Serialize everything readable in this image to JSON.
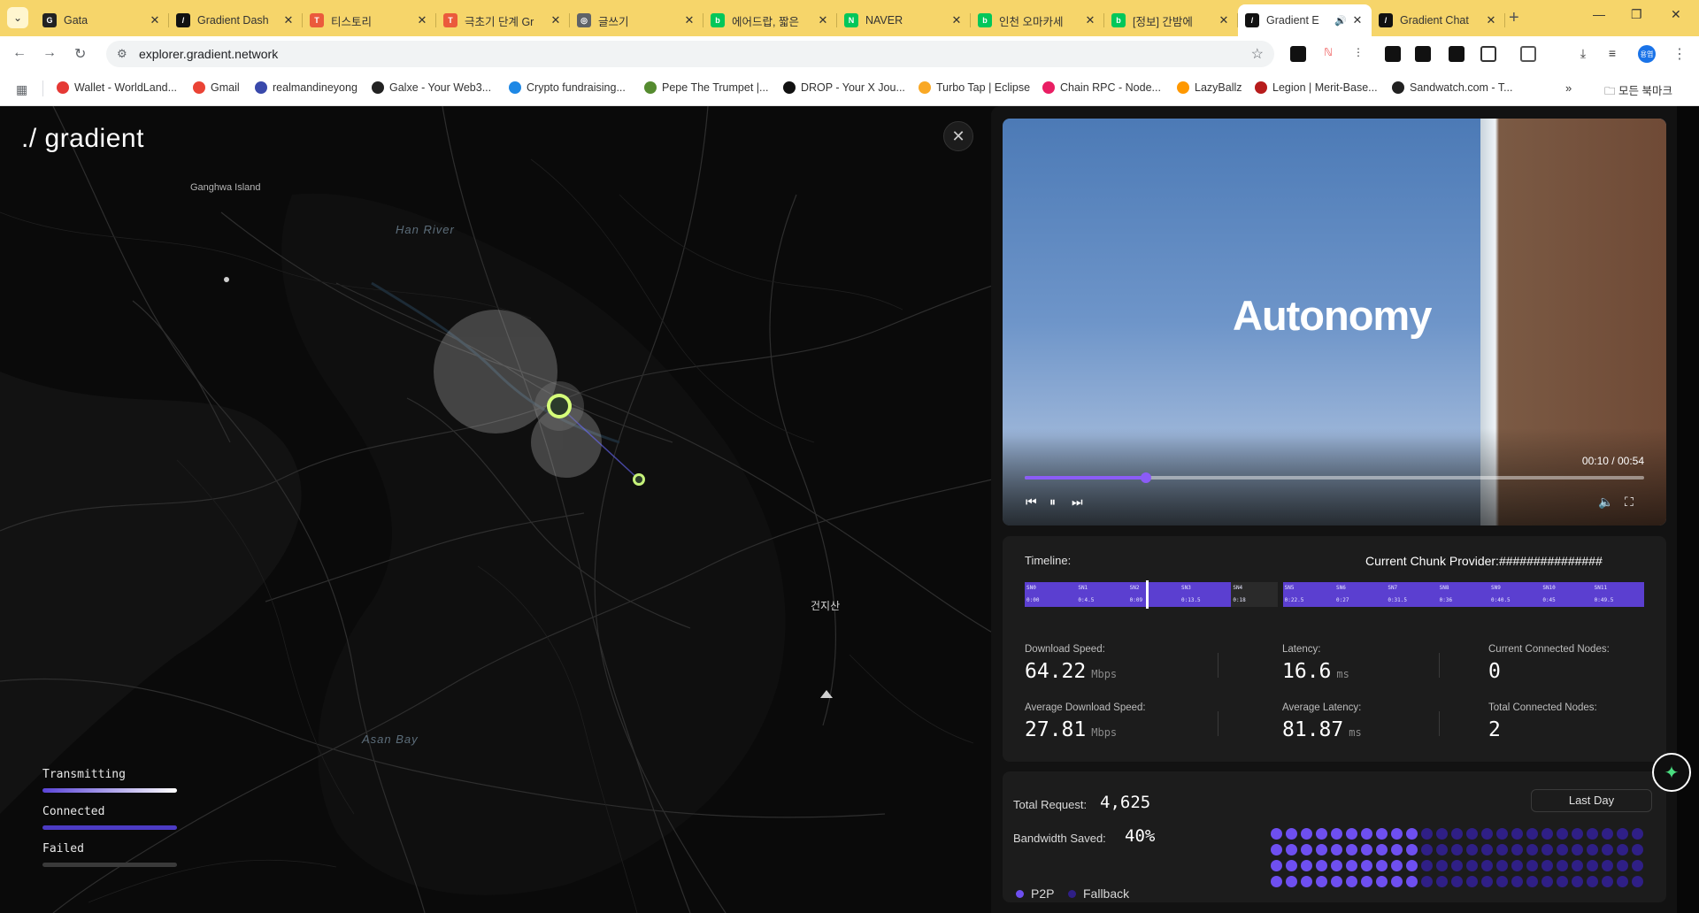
{
  "browser": {
    "tabs": [
      {
        "title": "Gata",
        "color": "#222222",
        "glyph": "G"
      },
      {
        "title": "Gradient Dash",
        "color": "#111111",
        "glyph": "/"
      },
      {
        "title": "티스토리",
        "color": "#eb5a3c",
        "glyph": "T"
      },
      {
        "title": "극초기 단계 Gr",
        "color": "#eb5a3c",
        "glyph": "T"
      },
      {
        "title": "글쓰기",
        "color": "#5f6368",
        "glyph": "◎"
      },
      {
        "title": "에어드랍, 짧은",
        "color": "#03c75a",
        "glyph": "b"
      },
      {
        "title": "NAVER",
        "color": "#03c75a",
        "glyph": "N"
      },
      {
        "title": "인천 오마카세",
        "color": "#03c75a",
        "glyph": "b"
      },
      {
        "title": "[정보] 간밤에",
        "color": "#03c75a",
        "glyph": "b"
      },
      {
        "title": "Gradient E",
        "color": "#111111",
        "glyph": "/"
      },
      {
        "title": "Gradient Chat",
        "color": "#111111",
        "glyph": "/"
      }
    ],
    "active_tab_index": 9,
    "url": "explorer.gradient.network",
    "bookmarks": [
      {
        "label": "Wallet - WorldLand...",
        "color": "#e53935"
      },
      {
        "label": "Gmail",
        "color": "#ea4335"
      },
      {
        "label": "realmandineyong",
        "color": "#3949ab"
      },
      {
        "label": "Galxe - Your Web3...",
        "color": "#222222"
      },
      {
        "label": "Crypto fundraising...",
        "color": "#1e88e5"
      },
      {
        "label": "Pepe The Trumpet |...",
        "color": "#558b2f"
      },
      {
        "label": "DROP - Your X Jou...",
        "color": "#111111"
      },
      {
        "label": "Turbo Tap | Eclipse",
        "color": "#f9a825"
      },
      {
        "label": "Chain RPC - Node...",
        "color": "#e91e63"
      },
      {
        "label": "LazyBallz",
        "color": "#ff9800"
      },
      {
        "label": "Legion | Merit-Base...",
        "color": "#b71c1c"
      },
      {
        "label": "Sandwatch.com - T...",
        "color": "#212121"
      }
    ],
    "bookmarks_more": "»",
    "all_bookmarks": "모든 북마크",
    "profile_initial": "용엽"
  },
  "map": {
    "logo": "./ gradient",
    "labels": {
      "ganghwa": "Ganghwa Island",
      "han_river": "Han River",
      "asan_bay": "Asan Bay",
      "geonjisan": "건지산"
    },
    "legend": [
      {
        "label": "Transmitting",
        "color": "#ffffff"
      },
      {
        "label": "Connected",
        "color": "#4c3bc4"
      },
      {
        "label": "Failed",
        "color": "#3a3a3a"
      }
    ]
  },
  "video": {
    "title": "Autonomy",
    "current_time": "00:10",
    "duration": "00:54",
    "progress": 0.195
  },
  "stats": {
    "timeline_label": "Timeline:",
    "provider_label": "Current Chunk Provider:",
    "provider_value": "###############",
    "segments": [
      {
        "sn": "SN0",
        "time": "0:00"
      },
      {
        "sn": "SN1",
        "time": "0:4.5"
      },
      {
        "sn": "SN2",
        "time": "0:09"
      },
      {
        "sn": "SN3",
        "time": "0:13.5"
      },
      {
        "sn": "SN4",
        "time": "0:18"
      },
      {
        "sn": "SN5",
        "time": "0:22.5"
      },
      {
        "sn": "SN6",
        "time": "0:27"
      },
      {
        "sn": "SN7",
        "time": "0:31.5"
      },
      {
        "sn": "SN8",
        "time": "0:36"
      },
      {
        "sn": "SN9",
        "time": "0:40.5"
      },
      {
        "sn": "SN10",
        "time": "0:45"
      },
      {
        "sn": "SN11",
        "time": "0:49.5"
      }
    ],
    "download_speed": {
      "label": "Download Speed:",
      "value": "64.22",
      "unit": "Mbps"
    },
    "latency": {
      "label": "Latency:",
      "value": "16.6",
      "unit": "ms"
    },
    "current_nodes": {
      "label": "Current Connected Nodes:",
      "value": "0"
    },
    "avg_download": {
      "label": "Average Download Speed:",
      "value": "27.81",
      "unit": "Mbps"
    },
    "avg_latency": {
      "label": "Average Latency:",
      "value": "81.87",
      "unit": "ms"
    },
    "total_nodes": {
      "label": "Total Connected Nodes:",
      "value": "2"
    }
  },
  "summary": {
    "total_request_label": "Total Request:",
    "total_request_value": "4,625",
    "bandwidth_label": "Bandwidth Saved:",
    "bandwidth_value": "40%",
    "range_button": "Last Day",
    "p2p_label": "P2P",
    "fallback_label": "Fallback",
    "colors": {
      "p2p": "#6e4ff0",
      "fallback": "#2f1f86"
    }
  }
}
